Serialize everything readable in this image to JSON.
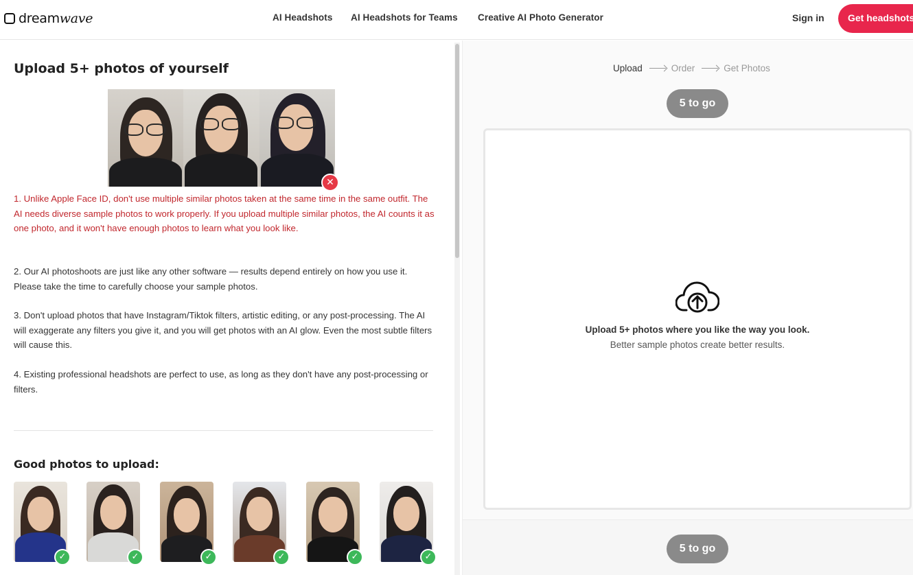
{
  "header": {
    "logo_plain": "dream",
    "logo_italic": "wave",
    "nav": [
      "AI Headshots",
      "AI Headshots for Teams",
      "Creative AI Photo Generator"
    ],
    "signin": "Sign in",
    "cta": "Get headshots"
  },
  "left": {
    "title": "Upload 5+ photos of yourself",
    "paragraphs": [
      "1. Unlike Apple Face ID, don't use multiple similar photos taken at the same time in the same outfit. The AI needs diverse sample photos to work properly. If you upload multiple similar photos, the AI counts it as one photo, and it won't have enough photos to learn what you look like.",
      "2. Our AI photoshoots are just like any other software — results depend entirely on how you use it. Please take the time to carefully choose your sample photos.",
      "3. Don't upload photos that have Instagram/Tiktok filters, artistic editing, or any post-processing. The AI will exaggerate any filters you give it, and you will get photos with an AI glow. Even the most subtle filters will cause this.",
      "4. Existing professional headshots are perfect to use, as long as they don't have any post-processing or filters."
    ],
    "good_title": "Good photos to upload:",
    "bad_badge": "✕",
    "good_badge": "✓"
  },
  "right": {
    "steps": [
      "Upload",
      "Order",
      "Get Photos"
    ],
    "counter_top": "5 to go",
    "counter_bottom": "5 to go",
    "dropzone_title": "Upload 5+ photos where you like the way you look.",
    "dropzone_sub": "Better sample photos create better results."
  },
  "colors": {
    "accent": "#e8264c",
    "warning_text": "#c1272d",
    "check": "#3db85a",
    "pill": "#8a8a8a"
  },
  "icons": {
    "upload": "cloud-upload-icon",
    "bad": "close-icon",
    "good": "checkmark-icon"
  }
}
